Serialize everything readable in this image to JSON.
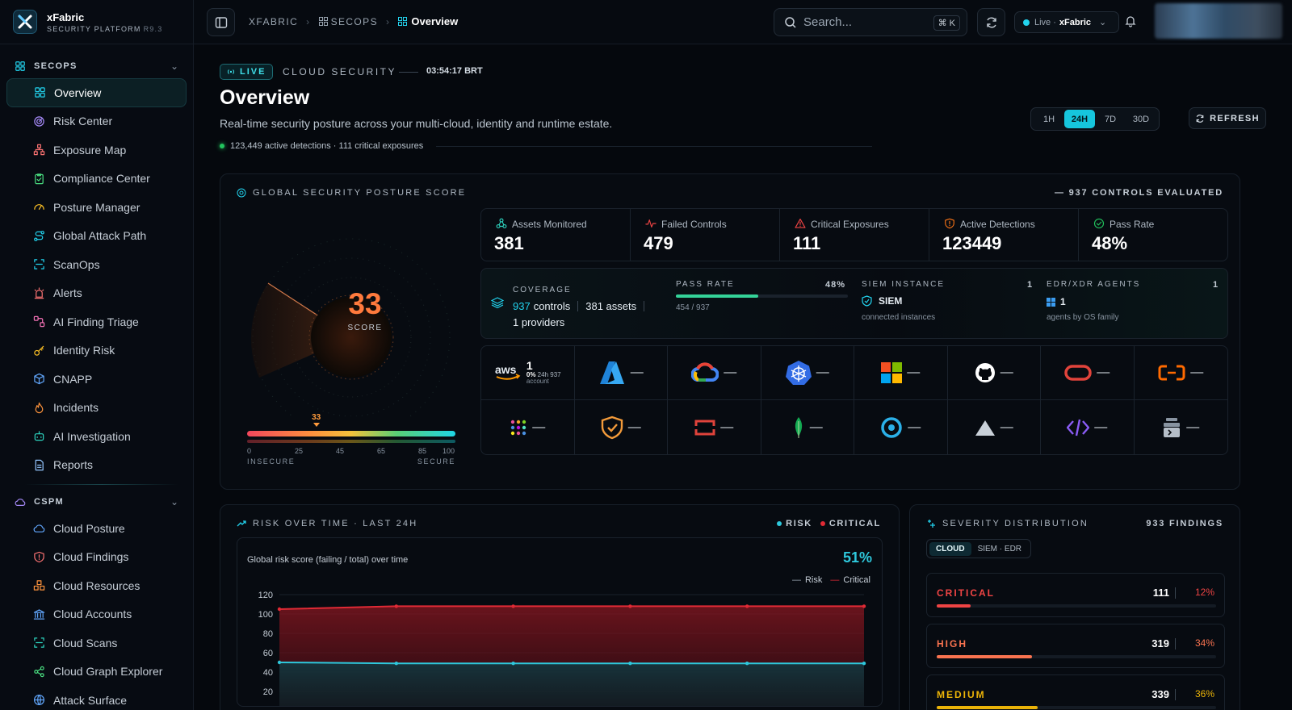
{
  "brand": {
    "title": "xFabric",
    "subtitle": "SECURITY PLATFORM",
    "version": "R9.3"
  },
  "sidebar": {
    "sections": [
      {
        "label": "SECOPS",
        "items": [
          {
            "label": "Overview",
            "icon": "grid-icon",
            "active": true
          },
          {
            "label": "Risk Center",
            "icon": "radar-icon"
          },
          {
            "label": "Exposure Map",
            "icon": "network-icon"
          },
          {
            "label": "Compliance Center",
            "icon": "clipboard-check-icon"
          },
          {
            "label": "Posture Manager",
            "icon": "gauge-icon"
          },
          {
            "label": "Global Attack Path",
            "icon": "route-icon"
          },
          {
            "label": "ScanOps",
            "icon": "scan-icon"
          },
          {
            "label": "Alerts",
            "icon": "siren-icon"
          },
          {
            "label": "AI Finding Triage",
            "icon": "workflow-icon"
          },
          {
            "label": "Identity Risk",
            "icon": "key-icon"
          },
          {
            "label": "CNAPP",
            "icon": "cube-icon"
          },
          {
            "label": "Incidents",
            "icon": "flame-icon"
          },
          {
            "label": "AI Investigation",
            "icon": "bot-icon"
          },
          {
            "label": "Reports",
            "icon": "file-icon"
          }
        ]
      },
      {
        "label": "CSPM",
        "items": [
          {
            "label": "Cloud Posture",
            "icon": "cloud-icon"
          },
          {
            "label": "Cloud Findings",
            "icon": "shield-alert-icon"
          },
          {
            "label": "Cloud Resources",
            "icon": "boxes-icon"
          },
          {
            "label": "Cloud Accounts",
            "icon": "bank-icon"
          },
          {
            "label": "Cloud Scans",
            "icon": "scan-icon"
          },
          {
            "label": "Cloud Graph Explorer",
            "icon": "share-icon"
          },
          {
            "label": "Attack Surface",
            "icon": "globe-icon"
          }
        ]
      }
    ]
  },
  "topbar": {
    "breadcrumb": [
      "XFABRIC",
      "SECOPS",
      "Overview"
    ],
    "search_placeholder": "Search...",
    "search_shortcut": "⌘ K",
    "live_label": "Live ·",
    "tenant": "xFabric"
  },
  "header": {
    "live_badge": "LIVE",
    "kicker": "CLOUD SECURITY",
    "clock": "03:54:17 BRT",
    "title": "Overview",
    "subtitle": "Real-time security posture across your multi-cloud, identity and runtime estate.",
    "detections": "123,449 active detections · 111 critical exposures",
    "ranges": [
      "1H",
      "24H",
      "7D",
      "30D"
    ],
    "active_range": "24H",
    "refresh_label": "REFRESH"
  },
  "posture": {
    "title": "GLOBAL SECURITY POSTURE SCORE",
    "controls_evaluated": "— 937 CONTROLS EVALUATED",
    "score": "33",
    "score_label": "SCORE",
    "scale_marker": "33",
    "scale_ticks": [
      "0",
      "25",
      "45",
      "65",
      "85",
      "100"
    ],
    "scale_left": "INSECURE",
    "scale_right": "SECURE",
    "stats": [
      {
        "label": "Assets Monitored",
        "value": "381",
        "icon": "nodes-icon",
        "color": "#2dd4bf"
      },
      {
        "label": "Failed Controls",
        "value": "479",
        "icon": "pulse-icon",
        "color": "#ef4444"
      },
      {
        "label": "Critical Exposures",
        "value": "111",
        "icon": "warning-icon",
        "color": "#ef4444"
      },
      {
        "label": "Active Detections",
        "value": "123449",
        "icon": "shield-icon",
        "color": "#f97316"
      },
      {
        "label": "Pass Rate",
        "value": "48%",
        "icon": "check-circle-icon",
        "color": "#22c55e"
      }
    ],
    "coverage": {
      "label": "COVERAGE",
      "controls_num": "937",
      "controls_word": "controls",
      "assets": "381 assets",
      "providers": "1 providers",
      "pass_rate_label": "PASS RATE",
      "pass_rate_value": "48%",
      "pass_rate_fraction": 0.48,
      "pass_rate_detail": "454 / 937",
      "siem_label": "SIEM INSTANCE",
      "siem_count": "1",
      "siem_name": "SIEM",
      "siem_caption": "connected instances",
      "edr_label": "EDR/XDR AGENTS",
      "edr_count": "1",
      "edr_value": "1",
      "edr_caption": "agents by OS family"
    },
    "aws": {
      "count": "1",
      "pct": "0%",
      "period": "24h",
      "total": "937",
      "unit": "account"
    },
    "provider_icons": [
      "aws-icon",
      "azure-icon",
      "gcp-icon",
      "kubernetes-icon",
      "microsoft-icon",
      "github-icon",
      "oracle-icon",
      "alibaba-icon",
      "dots-grid-icon",
      "shield-badge-icon",
      "ibm-icon",
      "mongodb-icon",
      "target-icon",
      "vercel-icon",
      "code-icon",
      "terminal-icon"
    ],
    "provider_dash": "—"
  },
  "risk": {
    "title": "RISK OVER TIME · LAST 24H",
    "legend_risk": "RISK",
    "legend_critical": "CRITICAL",
    "chart_caption": "Global risk score (failing / total) over time",
    "current_pct": "51%",
    "mini_legend_risk": "Risk",
    "mini_legend_critical": "Critical",
    "colors": {
      "risk": "#2ec8dc",
      "critical": "#e02a35"
    }
  },
  "chart_data": {
    "type": "area",
    "x": [
      0,
      1,
      2,
      3,
      4,
      5
    ],
    "series": [
      {
        "name": "Critical",
        "values": [
          105,
          108,
          108,
          108,
          108,
          108
        ]
      },
      {
        "name": "Risk",
        "values": [
          50,
          49,
          49,
          49,
          49,
          49
        ]
      }
    ],
    "ylim": [
      20,
      120
    ],
    "yticks": [
      "120",
      "100",
      "80",
      "60",
      "40",
      "20"
    ],
    "xlabel": "",
    "ylabel": "",
    "grid": true,
    "legend": "top-right"
  },
  "severity": {
    "title": "SEVERITY DISTRIBUTION",
    "total": "933 FINDINGS",
    "tabs": [
      "CLOUD",
      "SIEM · EDR"
    ],
    "active_tab": "CLOUD",
    "rows": [
      {
        "name": "CRITICAL",
        "count": "111",
        "pct": "12%",
        "fraction": 0.12,
        "color": "#ef4444"
      },
      {
        "name": "HIGH",
        "count": "319",
        "pct": "34%",
        "fraction": 0.34,
        "color": "#f97350"
      },
      {
        "name": "MEDIUM",
        "count": "339",
        "pct": "36%",
        "fraction": 0.36,
        "color": "#eab308"
      }
    ]
  }
}
